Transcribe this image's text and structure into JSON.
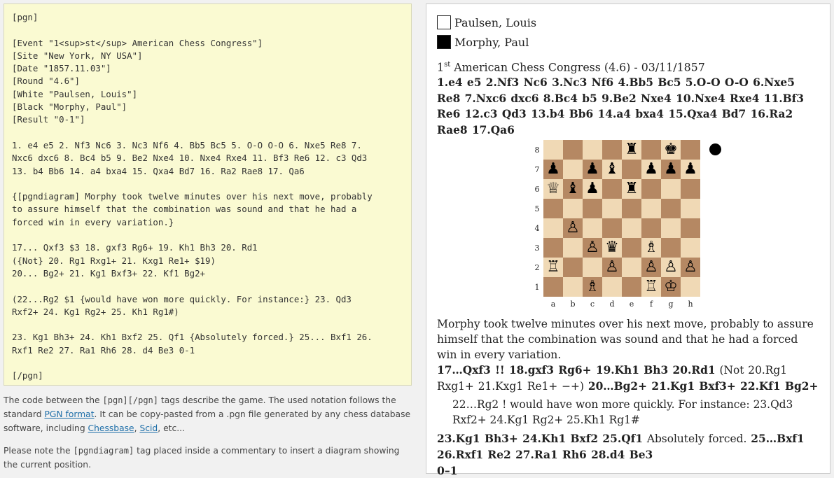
{
  "pgn_source": "[pgn]\n\n[Event \"1<sup>st</sup> American Chess Congress\"]\n[Site \"New York, NY USA\"]\n[Date \"1857.11.03\"]\n[Round \"4.6\"]\n[White \"Paulsen, Louis\"]\n[Black \"Morphy, Paul\"]\n[Result \"0-1\"]\n\n1. e4 e5 2. Nf3 Nc6 3. Nc3 Nf6 4. Bb5 Bc5 5. O-O O-O 6. Nxe5 Re8 7.\nNxc6 dxc6 8. Bc4 b5 9. Be2 Nxe4 10. Nxe4 Rxe4 11. Bf3 Re6 12. c3 Qd3\n13. b4 Bb6 14. a4 bxa4 15. Qxa4 Bd7 16. Ra2 Rae8 17. Qa6\n\n{[pgndiagram] Morphy took twelve minutes over his next move, probably\nto assure himself that the combination was sound and that he had a\nforced win in every variation.}\n\n17... Qxf3 $3 18. gxf3 Rg6+ 19. Kh1 Bh3 20. Rd1\n({Not} 20. Rg1 Rxg1+ 21. Kxg1 Re1+ $19)\n20... Bg2+ 21. Kg1 Bxf3+ 22. Kf1 Bg2+\n\n(22...Rg2 $1 {would have won more quickly. For instance:} 23. Qd3\nRxf2+ 24. Kg1 Rg2+ 25. Kh1 Rg1#)\n\n23. Kg1 Bh3+ 24. Kh1 Bxf2 25. Qf1 {Absolutely forced.} 25... Bxf1 26.\nRxf1 Re2 27. Ra1 Rh6 28. d4 Be3 0-1\n\n[/pgn]",
  "note1": {
    "t1": "The code between the ",
    "c1": "[pgn][/pgn]",
    "t2": " tags describe the game. The used notation follows the standard ",
    "link1": "PGN format",
    "t3": ". It can be copy-pasted from a .pgn file generated by any chess database software, including ",
    "link2": "Chessbase",
    "t4": ", ",
    "link3": "Scid",
    "t5": ", etc..."
  },
  "note2": {
    "t1": "Please note the ",
    "c1": "[pgndiagram]",
    "t2": " tag placed inside a commentary to insert a diagram showing the current position."
  },
  "game": {
    "white": "Paulsen, Louis",
    "black": "Morphy, Paul",
    "event_num": "1",
    "event_sup": "st",
    "event_rest": " American Chess Congress (4.6) - 03/11/1857",
    "main_moves": "1.e4 e5 2.Nf3 Nc6 3.Nc3 Nf6 4.Bb5 Bc5 5.O-O O-O 6.Nxe5 Re8 7.Nxc6 dxc6 8.Bc4 b5 9.Be2 Nxe4 10.Nxe4 Rxe4 11.Bf3 Re6 12.c3 Qd3 13.b4 Bb6 14.a4 bxa4 15.Qxa4 Bd7 16.Ra2 Rae8 17.Qa6",
    "comment": "Morphy took twelve minutes over his next move, probably to assure himself that the combination was sound and that he had a forced win in every variation.",
    "line2_a": "17…Qxf3 !! 18.gxf3 Rg6+ 19.Kh1 Bh3 20.Rd1",
    "line2_b": " (Not 20.Rg1 Rxg1+ 21.Kxg1 Re1+ −+) ",
    "line2_c": "20…Bg2+ 21.Kg1 Bxf3+ 22.Kf1 Bg2+",
    "variation": "22…Rg2 ! would have won more quickly. For instance: 23.Qd3 Rxf2+ 24.Kg1 Rg2+ 25.Kh1 Rg1#",
    "line3_a": "23.Kg1 Bh3+ 24.Kh1 Bxf2 25.Qf1",
    "line3_b": " Absolutely forced. ",
    "line3_c": "25…Bxf1 26.Rxf1 Re2 27.Ra1 Rh6 28.d4 Be3",
    "result": "0–1"
  },
  "board": {
    "ranks": [
      "8",
      "7",
      "6",
      "5",
      "4",
      "3",
      "2",
      "1"
    ],
    "files": [
      "a",
      "b",
      "c",
      "d",
      "e",
      "f",
      "g",
      "h"
    ],
    "rows": [
      [
        "",
        "",
        "",
        "",
        "♜",
        "",
        "♚",
        ""
      ],
      [
        "♟",
        "",
        "♟",
        "♝",
        "",
        "♟",
        "♟",
        "♟"
      ],
      [
        "♕",
        "♝",
        "♟",
        "",
        "♜",
        "",
        "",
        ""
      ],
      [
        "",
        "",
        "",
        "",
        "",
        "",
        "",
        ""
      ],
      [
        "",
        "♙",
        "",
        "",
        "",
        "",
        "",
        ""
      ],
      [
        "",
        "",
        "♙",
        "♛",
        "",
        "♗",
        "",
        ""
      ],
      [
        "♖",
        "",
        "",
        "♙",
        "",
        "♙",
        "♙",
        "♙"
      ],
      [
        "",
        "",
        "♗",
        "",
        "",
        "♖",
        "♔",
        ""
      ]
    ],
    "side_to_move": "black"
  }
}
